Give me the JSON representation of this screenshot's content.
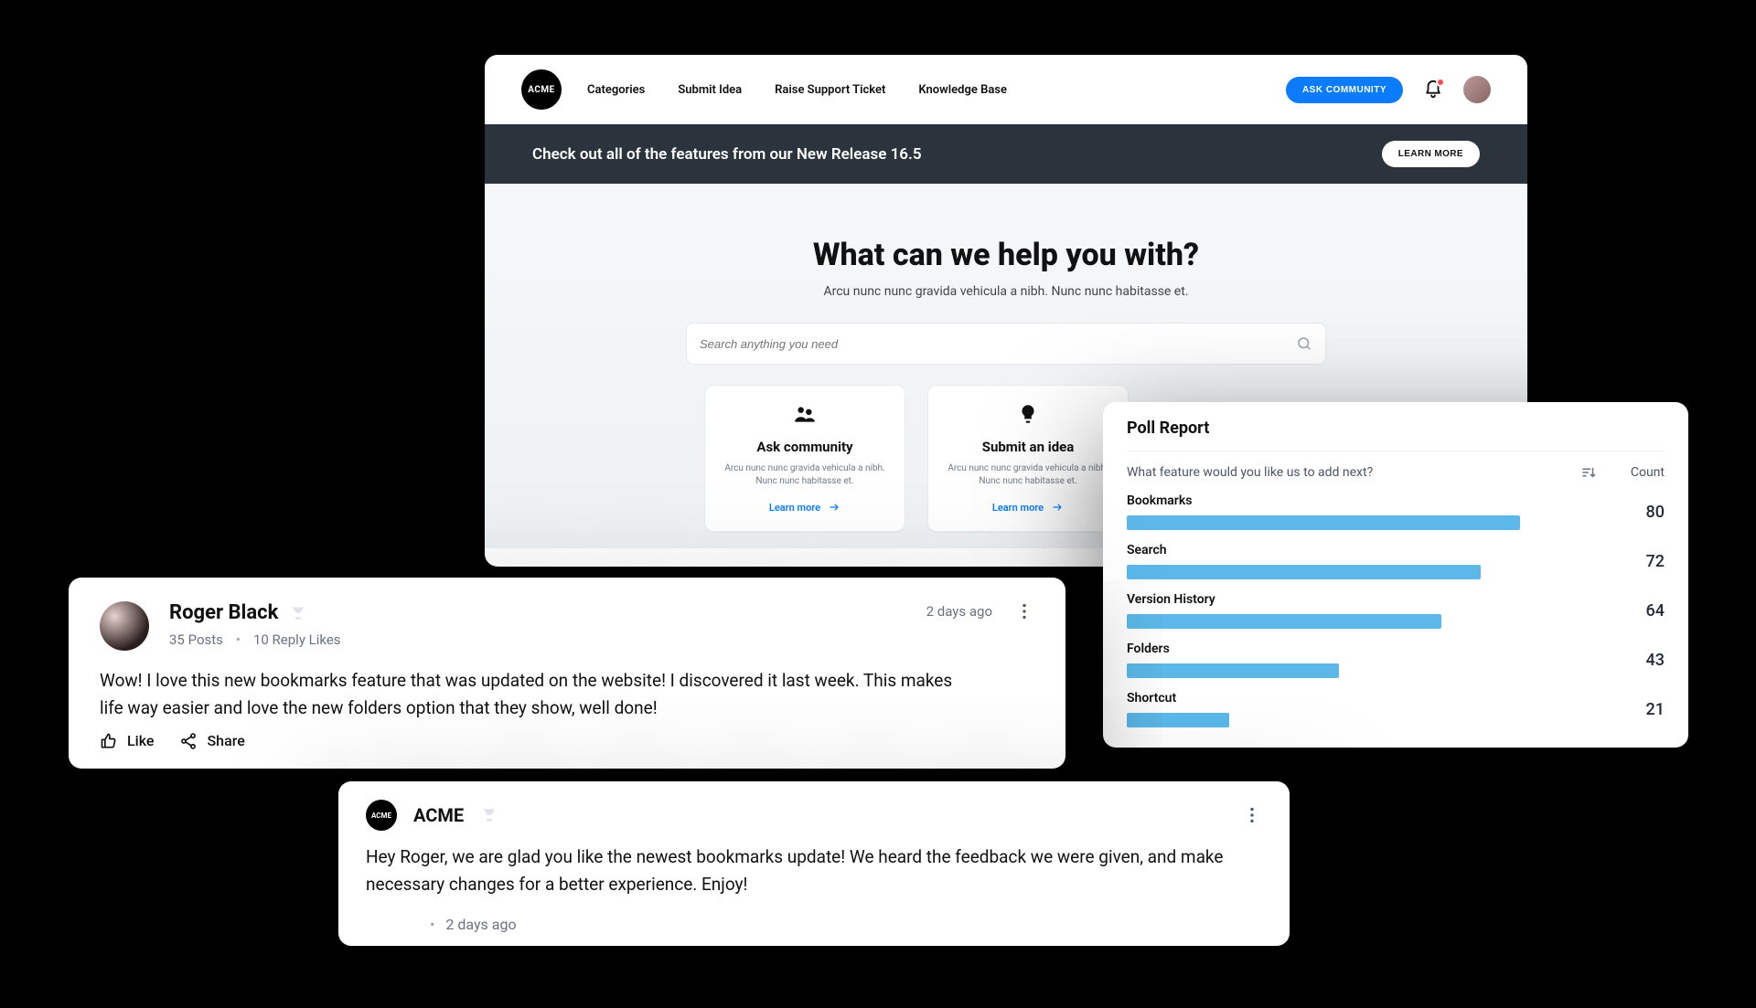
{
  "brand": {
    "name": "ACME"
  },
  "nav": {
    "items": [
      "Categories",
      "Submit Idea",
      "Raise Support Ticket",
      "Knowledge Base"
    ],
    "ask_label": "ASK COMMUNITY"
  },
  "banner": {
    "text": "Check out all of the features from our New Release 16.5",
    "cta": "LEARN MORE"
  },
  "hero": {
    "title": "What can we help you with?",
    "subtitle": "Arcu nunc nunc gravida vehicula a nibh. Nunc nunc habitasse et.",
    "search_placeholder": "Search anything you need"
  },
  "cards": [
    {
      "title": "Ask community",
      "desc": "Arcu nunc nunc gravida vehicula a nibh. Nunc nunc habitasse et.",
      "cta": "Learn more",
      "icon": "people-icon"
    },
    {
      "title": "Submit an idea",
      "desc": "Arcu nunc nunc gravida vehicula a nibh. Nunc nunc habitasse et.",
      "cta": "Learn more",
      "icon": "lightbulb-icon"
    }
  ],
  "poll": {
    "title": "Poll Report",
    "question": "What feature would you like us to add next?",
    "count_header": "Count",
    "rows": [
      {
        "label": "Bookmarks",
        "count": 80
      },
      {
        "label": "Search",
        "count": 72
      },
      {
        "label": "Version History",
        "count": 64
      },
      {
        "label": "Folders",
        "count": 43
      },
      {
        "label": "Shortcut",
        "count": 21
      }
    ],
    "max": 80
  },
  "post": {
    "author": "Roger Black",
    "posts_count": "35 Posts",
    "reply_likes": "10 Reply Likes",
    "time": "2 days ago",
    "body": "Wow! I love this new bookmarks feature that was updated on the website! I discovered it last week. This makes life way easier and love the new folders option that they show, well done!",
    "like_label": "Like",
    "share_label": "Share"
  },
  "reply": {
    "author": "ACME",
    "body": "Hey Roger, we are glad you like the newest bookmarks update! We heard the feedback we were given, and make necessary changes for a better experience. Enjoy!",
    "time": "2 days ago"
  },
  "chart_data": {
    "type": "bar",
    "orientation": "horizontal",
    "title": "Poll Report",
    "xlabel": "Count",
    "ylabel": "What feature would you like us to add next?",
    "categories": [
      "Bookmarks",
      "Search",
      "Version History",
      "Folders",
      "Shortcut"
    ],
    "values": [
      80,
      72,
      64,
      43,
      21
    ],
    "xlim": [
      0,
      80
    ]
  }
}
